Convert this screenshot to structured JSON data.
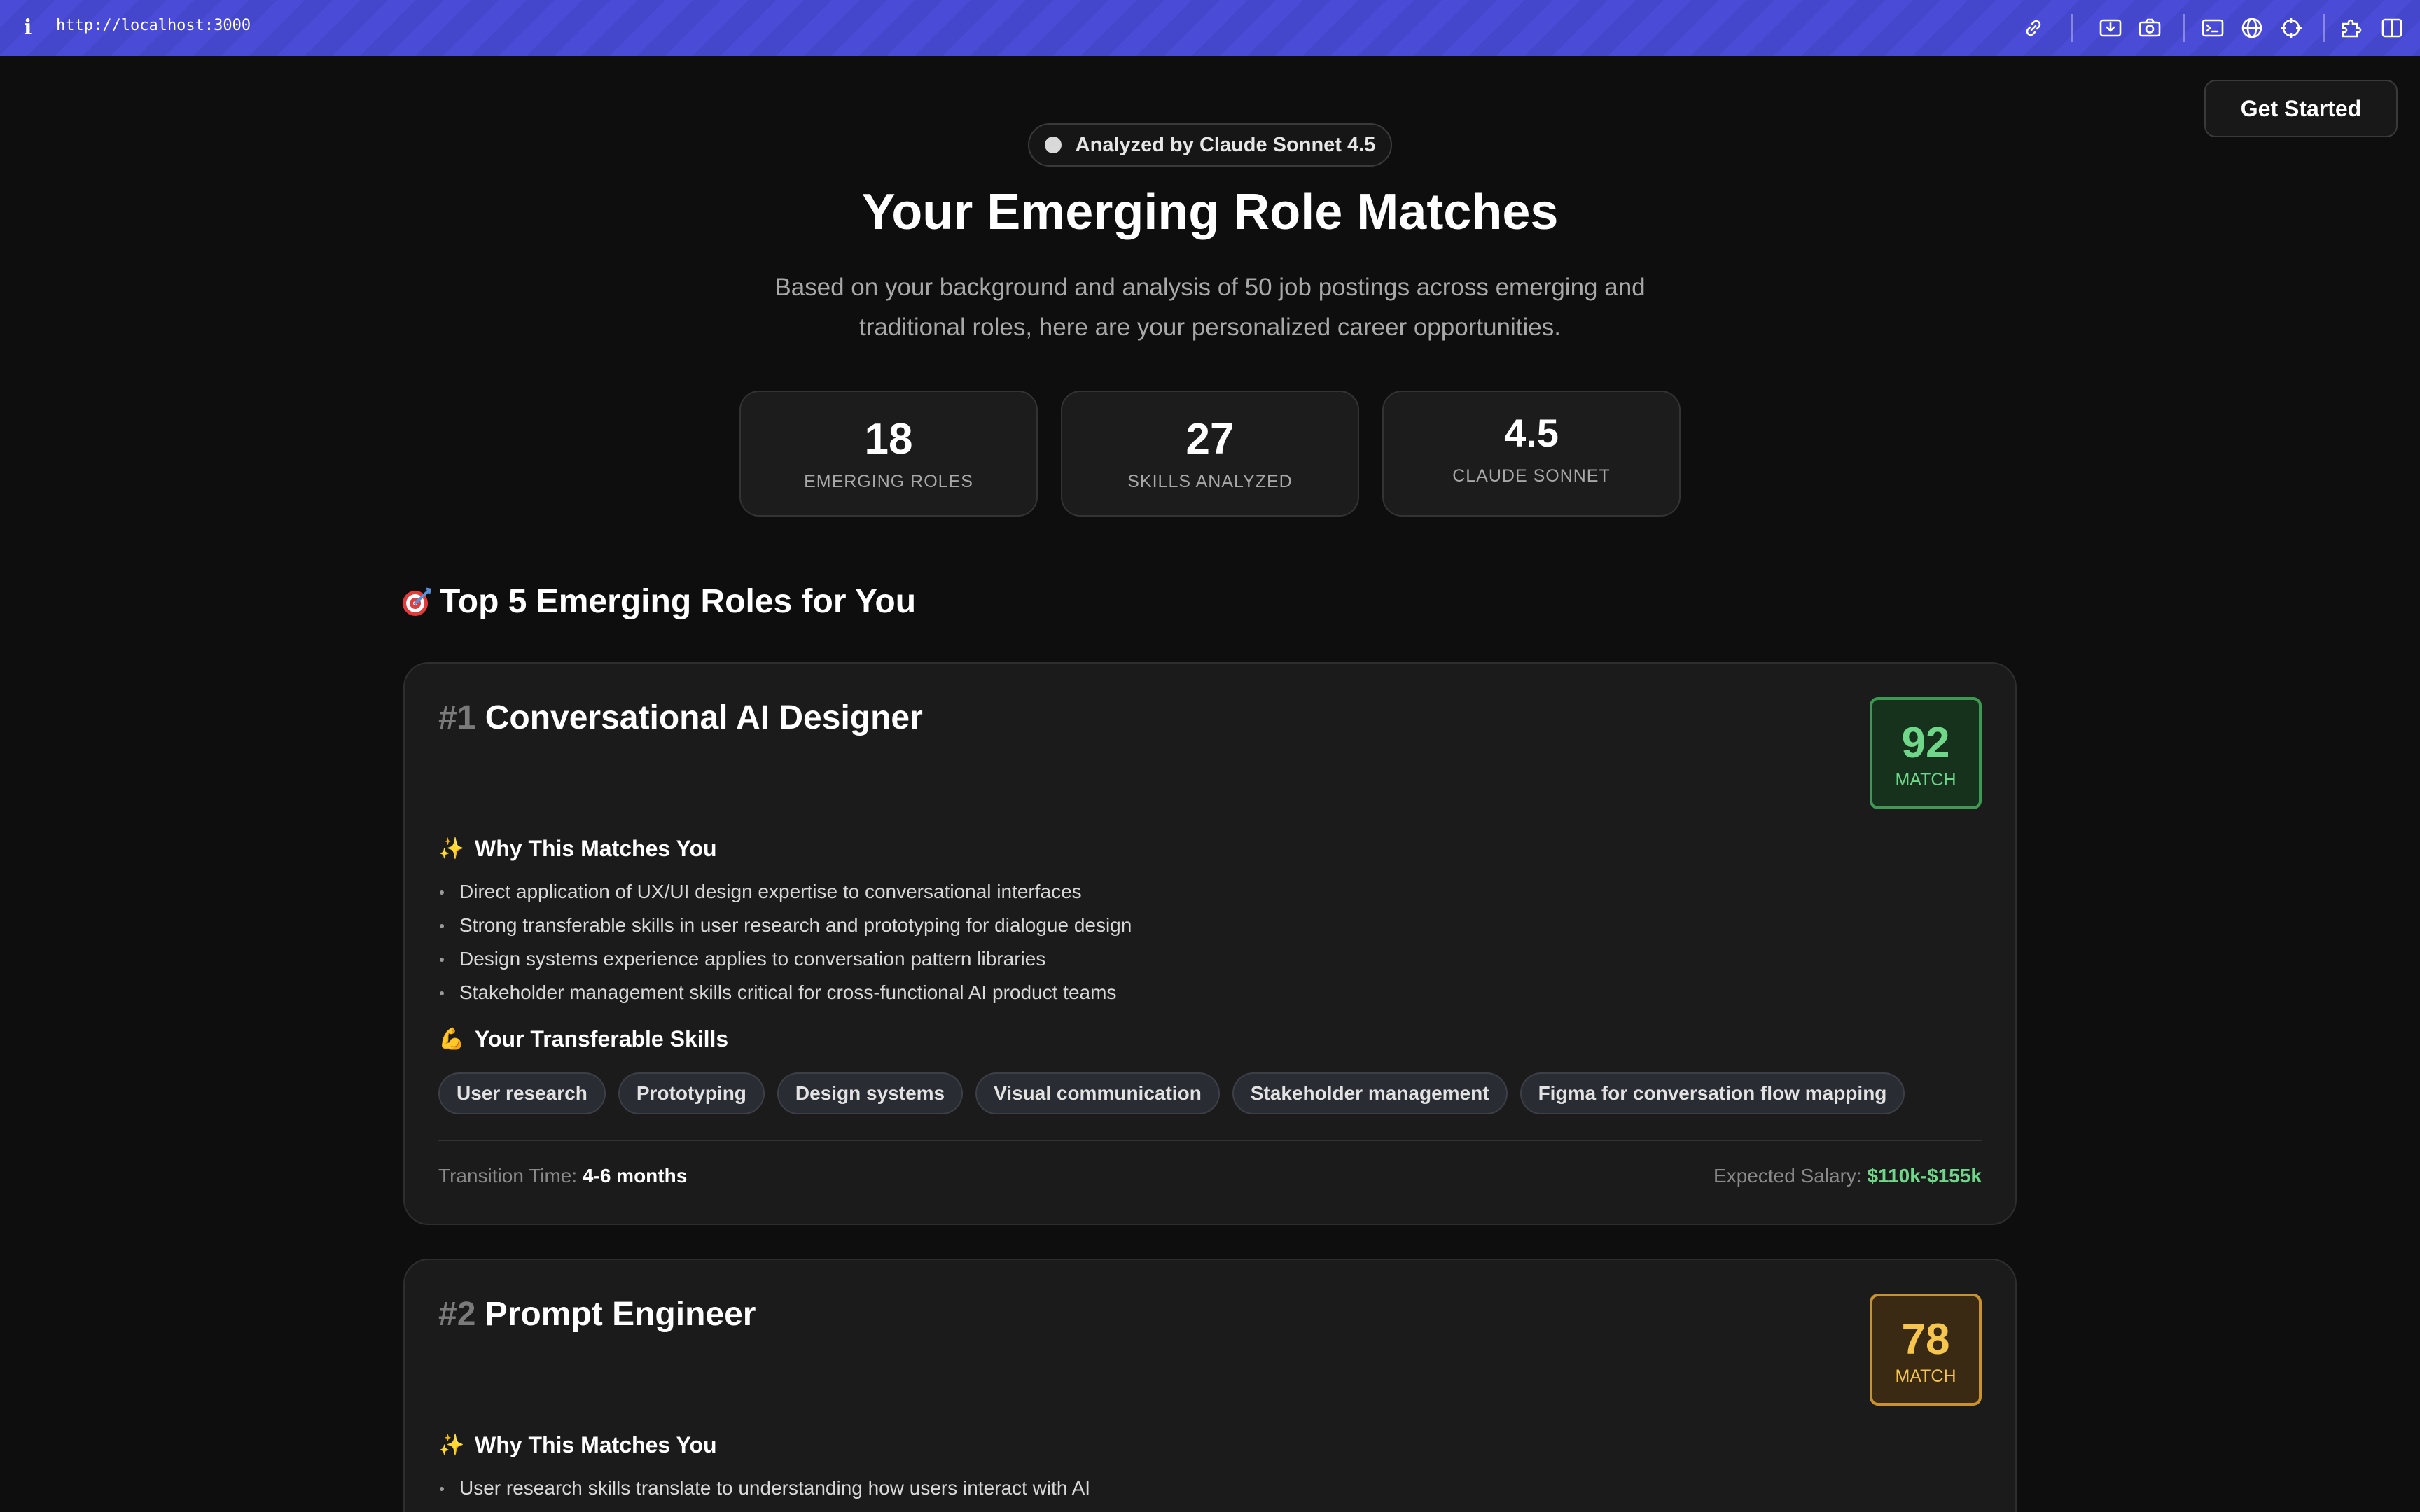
{
  "browser": {
    "url": "http://localhost:3000",
    "info_glyph": "i",
    "toolbar_icons": [
      "link-icon",
      "download-icon",
      "camera-icon",
      "terminal-icon",
      "globe-icon",
      "crosshair-icon",
      "extensions-icon",
      "sidebar-icon"
    ]
  },
  "header": {
    "cta_label": "Get Started"
  },
  "hero": {
    "badge": "Analyzed by Claude Sonnet 4.5",
    "title": "Your Emerging Role Matches",
    "subtitle": "Based on your background and analysis of 50 job postings across emerging and traditional roles, here are your personalized career opportunities."
  },
  "stats": [
    {
      "value": "18",
      "label": "EMERGING ROLES"
    },
    {
      "value": "27",
      "label": "SKILLS ANALYZED"
    },
    {
      "value": "4.5",
      "label": "CLAUDE SONNET"
    }
  ],
  "section": {
    "icon": "target-icon",
    "title": "Top 5 Emerging Roles for You"
  },
  "roles": [
    {
      "rank": "#1",
      "title": "Conversational AI Designer",
      "match": "92",
      "match_label": "MATCH",
      "match_color": "#6fd68a",
      "why_heading": "Why This Matches You",
      "why_emoji": "✨",
      "reasons": [
        "Direct application of UX/UI design expertise to conversational interfaces",
        "Strong transferable skills in user research and prototyping for dialogue design",
        "Design systems experience applies to conversation pattern libraries",
        "Stakeholder management skills critical for cross-functional AI product teams"
      ],
      "skills_heading": "Your Transferable Skills",
      "skills_emoji": "💪",
      "skills": [
        "User research",
        "Prototyping",
        "Design systems",
        "Visual communication",
        "Stakeholder management",
        "Figma for conversation flow mapping"
      ],
      "transition_label": "Transition Time:",
      "transition_value": "4-6 months",
      "salary_label": "Expected Salary:",
      "salary_value": "$110k-$155k"
    },
    {
      "rank": "#2",
      "title": "Prompt Engineer",
      "match": "78",
      "match_label": "MATCH",
      "match_color": "#f5c54d",
      "why_heading": "Why This Matches You",
      "why_emoji": "✨",
      "reasons": [
        "User research skills translate to understanding how users interact with AI"
      ]
    }
  ]
}
